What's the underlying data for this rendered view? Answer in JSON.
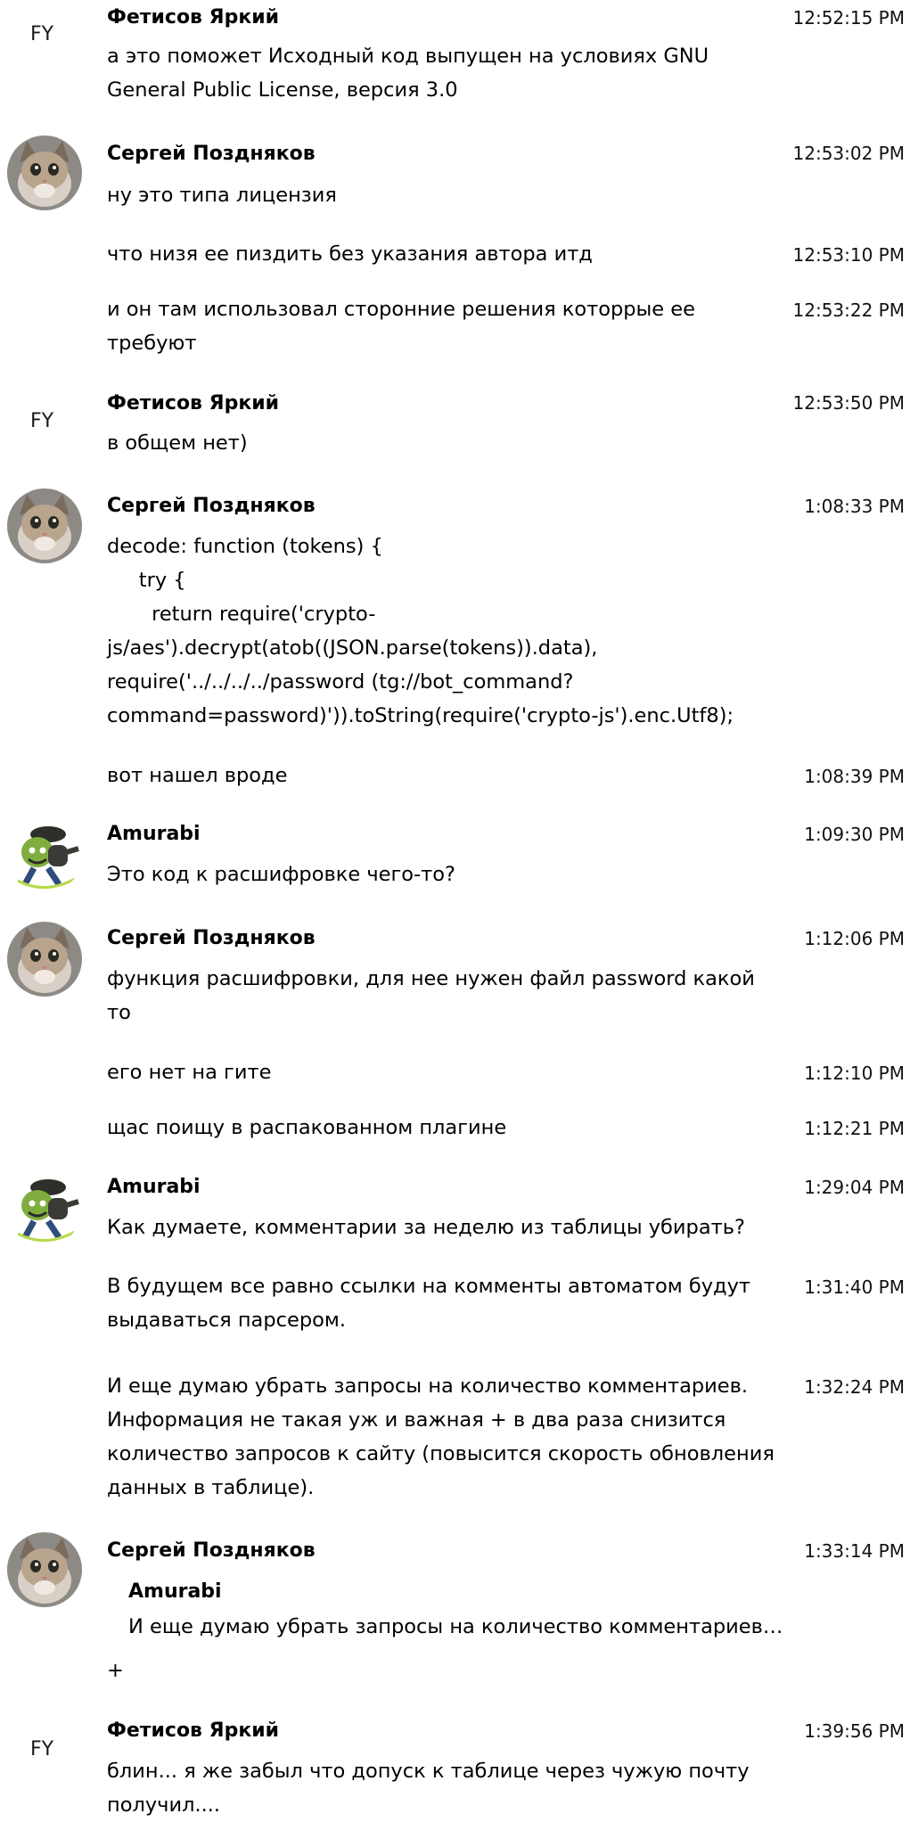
{
  "messages": [
    {
      "initials": "FY",
      "author": "Фетисов Яркий",
      "time": "12:52:15 PM",
      "text": "а это поможет Исходный код выпущен на условиях GNU\nGeneral Public License, версия 3.0"
    },
    {
      "author": "Сергей Поздняков",
      "time": "12:53:02 PM",
      "text": "ну это типа лицензия"
    },
    {
      "time": "12:53:10 PM",
      "text": "что низя ее пиздить без указания автора итд"
    },
    {
      "time": "12:53:22 PM",
      "text": "и он там использовал сторонние решения которрые ее\nтребуют"
    },
    {
      "initials": "FY",
      "author": "Фетисов Яркий",
      "time": "12:53:50 PM",
      "text": "в общем нет)"
    },
    {
      "author": "Сергей Поздняков",
      "time": "1:08:33 PM",
      "text": "decode: function (tokens) {\n     try {\n       return require('crypto-\njs/aes').decrypt(atob((JSON.parse(tokens)).data),\nrequire('../../../../password (tg://bot_command?\ncommand=password)')).toString(require('crypto-js').enc.Utf8);"
    },
    {
      "time": "1:08:39 PM",
      "text": "вот нашел вроде"
    },
    {
      "author": "Amurabi",
      "time": "1:09:30 PM",
      "text": "Это код к расшифровке чего-то?"
    },
    {
      "author": "Сергей Поздняков",
      "time": "1:12:06 PM",
      "text": "функция расшифровки, для нее нужен файл password какой\nто"
    },
    {
      "time": "1:12:10 PM",
      "text": "его нет на гите"
    },
    {
      "time": "1:12:21 PM",
      "text": "щас поищу в распакованном плагине"
    },
    {
      "author": "Amurabi",
      "time": "1:29:04 PM",
      "text": "Как думаете, комментарии за неделю из таблицы убирать?"
    },
    {
      "time": "1:31:40 PM",
      "text": "В будущем все равно ссылки на комменты автоматом будут\nвыдаваться парсером."
    },
    {
      "time": "1:32:24 PM",
      "text": "И еще думаю убрать запросы на количество комментариев.\nИнформация не такая уж и важная + в два раза снизится\nколичество запросов к сайту (повысится скорость обновления\nданных в таблице)."
    },
    {
      "author": "Сергей Поздняков",
      "time": "1:33:14 PM",
      "quote_author": "Amurabi",
      "quote_text": "И еще думаю убрать запросы на количество комментариев…",
      "text": "+"
    },
    {
      "initials": "FY",
      "author": "Фетисов Яркий",
      "time": "1:39:56 PM",
      "text": "блин... я же забыл что допуск к таблице через чужую почту\nполучил...."
    }
  ]
}
